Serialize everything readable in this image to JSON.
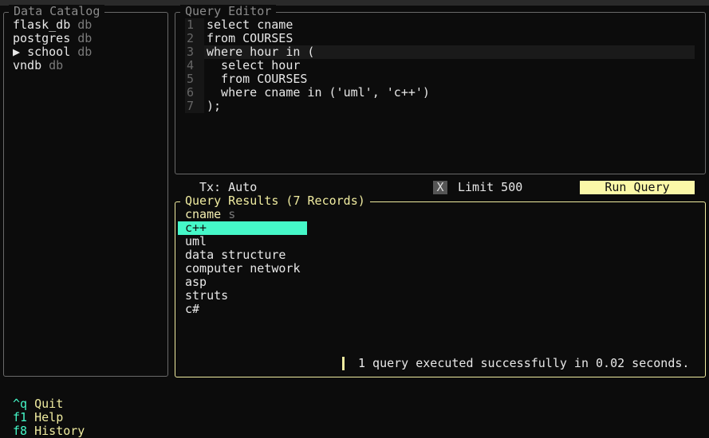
{
  "catalog": {
    "title": "Data Catalog",
    "items": [
      {
        "name": "flask_db",
        "type": "db",
        "expanded": false
      },
      {
        "name": "postgres",
        "type": "db",
        "expanded": false
      },
      {
        "name": "school",
        "type": "db",
        "expanded": false,
        "arrow": "▶"
      },
      {
        "name": "vndb",
        "type": "db",
        "expanded": false
      }
    ]
  },
  "editor": {
    "title": "Query Editor",
    "lines": [
      {
        "n": "1",
        "code": "select cname"
      },
      {
        "n": "2",
        "code": "from COURSES"
      },
      {
        "n": "3",
        "code": "where hour in ("
      },
      {
        "n": "4",
        "code": "  select hour"
      },
      {
        "n": "5",
        "code": "  from COURSES"
      },
      {
        "n": "6",
        "code": "  where cname in ('uml', 'c++')"
      },
      {
        "n": "7",
        "code": ");"
      }
    ]
  },
  "toolbar": {
    "tx": "Tx: Auto",
    "limit_check": "X",
    "limit": "Limit 500",
    "run": "Run Query"
  },
  "results": {
    "title": "Query Results (7 Records)",
    "column": "cname",
    "column_type": "s",
    "rows": [
      "c++",
      "uml",
      "data structure",
      "computer network",
      "asp",
      "struts",
      "c#"
    ],
    "status": "1 query executed successfully in 0.02 seconds."
  },
  "footer": [
    {
      "key": "^q",
      "label": "Quit"
    },
    {
      "key": "f1",
      "label": "Help"
    },
    {
      "key": "f8",
      "label": "History"
    }
  ]
}
